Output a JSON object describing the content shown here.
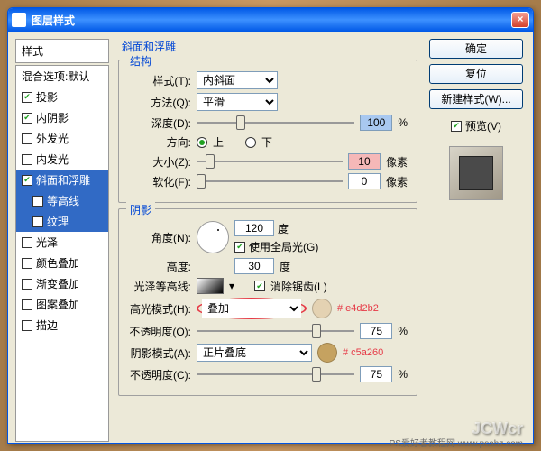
{
  "title": "图层样式",
  "left": {
    "header": "样式",
    "items": [
      {
        "label": "混合选项:默认",
        "checked": null
      },
      {
        "label": "投影",
        "checked": true
      },
      {
        "label": "内阴影",
        "checked": true
      },
      {
        "label": "外发光",
        "checked": false
      },
      {
        "label": "内发光",
        "checked": false
      },
      {
        "label": "斜面和浮雕",
        "checked": true,
        "selected": true
      },
      {
        "label": "等高线",
        "checked": false,
        "sub": true
      },
      {
        "label": "纹理",
        "checked": false,
        "sub": true
      },
      {
        "label": "光泽",
        "checked": false
      },
      {
        "label": "颜色叠加",
        "checked": false
      },
      {
        "label": "渐变叠加",
        "checked": false
      },
      {
        "label": "图案叠加",
        "checked": false
      },
      {
        "label": "描边",
        "checked": false
      }
    ]
  },
  "bevel": {
    "title": "斜面和浮雕",
    "structure": {
      "legend": "结构",
      "style_label": "样式(T):",
      "style_value": "内斜面",
      "tech_label": "方法(Q):",
      "tech_value": "平滑",
      "depth_label": "深度(D):",
      "depth_value": "100",
      "depth_unit": "%",
      "dir_label": "方向:",
      "up": "上",
      "down": "下",
      "size_label": "大小(Z):",
      "size_value": "10",
      "size_unit": "像素",
      "soften_label": "软化(F):",
      "soften_value": "0",
      "soften_unit": "像素"
    },
    "shadow": {
      "legend": "阴影",
      "angle_label": "角度(N):",
      "angle_value": "120",
      "angle_unit": "度",
      "global_label": "使用全局光(G)",
      "alt_label": "高度:",
      "alt_value": "30",
      "alt_unit": "度",
      "contour_label": "光泽等高线:",
      "anti_label": "消除锯齿(L)",
      "hl_mode_label": "高光模式(H):",
      "hl_mode_value": "叠加",
      "hl_color": "#e4d2b2",
      "hl_annot": "# e4d2b2",
      "hl_opacity_label": "不透明度(O):",
      "hl_opacity_value": "75",
      "pct": "%",
      "sh_mode_label": "阴影模式(A):",
      "sh_mode_value": "正片叠底",
      "sh_color": "#c5a260",
      "sh_annot": "# c5a260",
      "sh_opacity_label": "不透明度(C):",
      "sh_opacity_value": "75"
    }
  },
  "right": {
    "ok": "确定",
    "cancel": "复位",
    "new_style": "新建样式(W)...",
    "preview": "预览(V)"
  },
  "watermark": "JCWcr",
  "wm2": "PS爱好者教程网  www.psahz.com"
}
